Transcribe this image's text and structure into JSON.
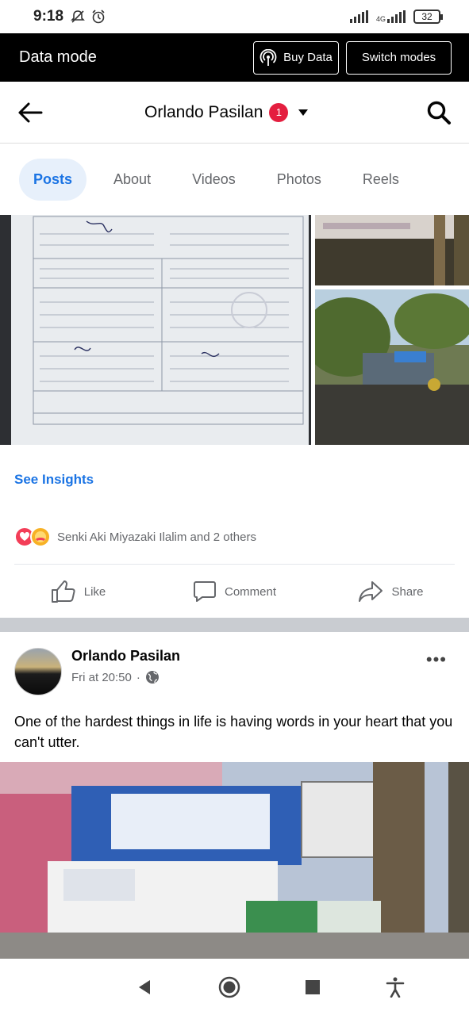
{
  "status_bar": {
    "time": "9:18",
    "network_label": "4G",
    "battery": "32",
    "icons": [
      "mute-bell-icon",
      "alarm-icon",
      "signal-icon",
      "signal-4g-icon",
      "battery-icon"
    ]
  },
  "data_mode": {
    "title": "Data mode",
    "buy_data_label": "Buy Data",
    "switch_modes_label": "Switch modes"
  },
  "header": {
    "name": "Orlando Pasilan",
    "notification_count": "1"
  },
  "tabs": [
    {
      "label": "Posts",
      "active": true
    },
    {
      "label": "About",
      "active": false
    },
    {
      "label": "Videos",
      "active": false
    },
    {
      "label": "Photos",
      "active": false
    },
    {
      "label": "Reels",
      "active": false
    }
  ],
  "post1": {
    "see_insights": "See Insights",
    "reactions_text": "Senki Aki Miyazaki Ilalim and 2 others",
    "actions": {
      "like": "Like",
      "comment": "Comment",
      "share": "Share"
    }
  },
  "post2": {
    "author": "Orlando Pasilan",
    "time": "Fri at 20:50",
    "separator": "·",
    "text": "One of the hardest things in life is having words in your heart that you can't utter."
  },
  "colors": {
    "accent_blue": "#1b74e4",
    "badge_red": "#e41e3f",
    "data_mode_bg": "#000000"
  }
}
